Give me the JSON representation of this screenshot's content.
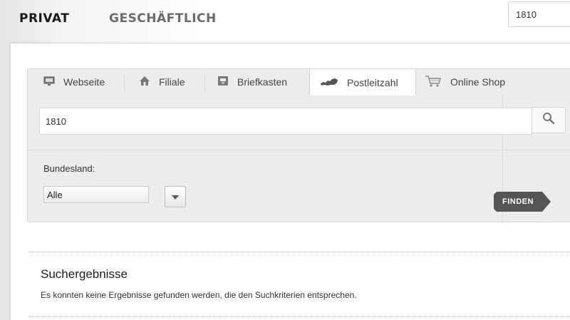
{
  "topnav": {
    "privat": "PRIVAT",
    "geschaeftlich": "GESCHÄFTLICH",
    "search_value": "1810"
  },
  "tabs": [
    {
      "label": "Webseite",
      "icon": "monitor-icon"
    },
    {
      "label": "Filiale",
      "icon": "house-icon"
    },
    {
      "label": "Briefkasten",
      "icon": "mailbox-icon"
    },
    {
      "label": "Postleitzahl",
      "icon": "austria-map-icon",
      "active": true
    },
    {
      "label": "Online Shop",
      "icon": "shopping-cart-icon"
    }
  ],
  "search": {
    "value": "1810",
    "button_icon": "magnifier-icon"
  },
  "filter": {
    "label": "Bundesland:",
    "selected": "Alle"
  },
  "finden_label": "FINDEN",
  "results": {
    "title": "Suchergebnisse",
    "message": "Es konnten keine Ergebnisse gefunden werden, die den Suchkriterien entsprechen."
  },
  "colors": {
    "accent_dark": "#555555",
    "nav_active": "#1a1a1a",
    "nav_inactive": "#6a6a6a"
  }
}
